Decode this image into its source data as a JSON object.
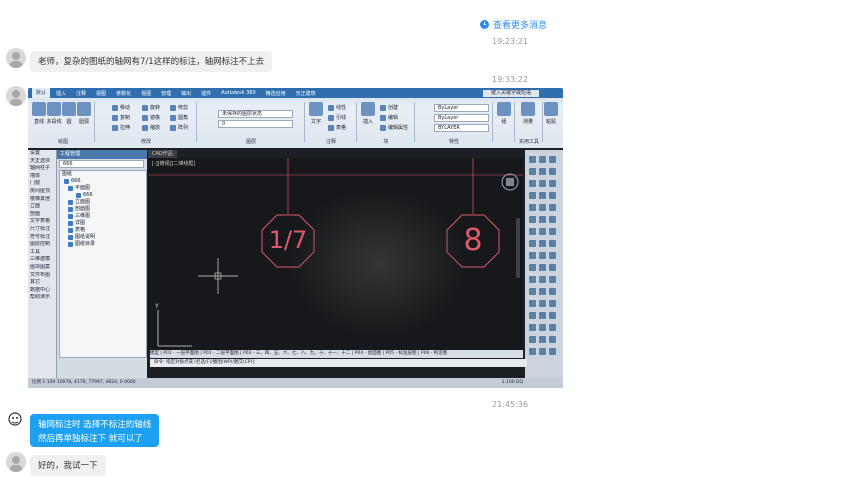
{
  "chat": {
    "more_messages": "查看更多消息",
    "messages": [
      {
        "time": "19:23:21",
        "sender": "other",
        "lines": [
          "老师，复杂的图纸的轴网有7/1这样的标注，轴网标注不上去"
        ]
      },
      {
        "time": "19:33:22",
        "sender": "other",
        "type": "image"
      },
      {
        "time": "21:45:36",
        "sender": "self",
        "lines": [
          "轴网标注时 选择不标注的轴线",
          "然后再单独标注下 就可以了"
        ]
      },
      {
        "sender": "other",
        "lines": [
          "好的，我试一下"
        ]
      }
    ]
  },
  "cad": {
    "tabs": [
      "默认",
      "插入",
      "注释",
      "视图",
      "参数化",
      "视图",
      "管理",
      "输出",
      "插件",
      "Autodesk 360",
      "精选应用",
      "天正建筑"
    ],
    "search_field": "键入关键字或短语",
    "tools": {
      "draw": [
        "直线",
        "多段线",
        "圆",
        "圆弧"
      ],
      "modify": [
        "移动",
        "旋转",
        "修剪",
        "复制",
        "镜像",
        "圆角",
        "拉伸",
        "缩放",
        "阵列"
      ],
      "text_big": "文字",
      "annotate": [
        "线性",
        "引线",
        "表格"
      ],
      "block_big": "插入",
      "block": [
        "创建",
        "编辑",
        "编辑属性"
      ],
      "props": [
        "ByLayer",
        "ByLayer",
        "BYLAYER"
      ],
      "match": "特性匹配",
      "group_label": "组",
      "measure": "测量",
      "paste": "粘贴"
    },
    "group_labels": [
      "绘图",
      "修改",
      "图层",
      "注释",
      "块",
      "特性",
      "组",
      "实用工具",
      "剪贴板"
    ],
    "layer_state": "未保存的图层状态",
    "layer_value": "0",
    "left_items": [
      "设置",
      "天正选项",
      "轴网柱子",
      "墙体",
      "门窗",
      "房间屋顶",
      "楼梯其他",
      "立面",
      "剖面",
      "文字表格",
      "尺寸标注",
      "符号标注",
      "图层控制",
      "工具",
      "三维建模",
      "图块图案",
      "文件布图",
      "其它",
      "数据中心",
      "帮助演示"
    ],
    "tree_title": "工程管理",
    "tree_project": "666",
    "tree_section": "图纸",
    "tree_nodes": [
      "666",
      "平面图",
      "666",
      "立面图",
      "剖面图",
      "三维图",
      "详图",
      "表格",
      "图纸说明",
      "图纸目录"
    ],
    "doc_tab": "CAD作品",
    "view_label": "[-][俯视][二维线框]",
    "axis_labels": [
      "1/7",
      "8"
    ],
    "layout_tabs": "模型 | P01 - 一层平面图 | P01 - 二层平面图 | P03 - 三、四、五、六、七、八、九、十、十一、十二 | P04 - 屋面图 | P05 - 标准层图 | P06 - 构造图",
    "command": "命令:  指定对角点或 [栏选(F)/圈围(WP)/圈交(CP)]:",
    "status": "比例 1:100   10078, 4176, 77997, 4824, 0.0000",
    "scale_text": "1:100  DQ"
  },
  "colors": {
    "link": "#2d8cf0",
    "self_bubble": "#1ea0f0",
    "other_bubble": "#f0f0f0",
    "axis_red": "#e05a6a"
  }
}
